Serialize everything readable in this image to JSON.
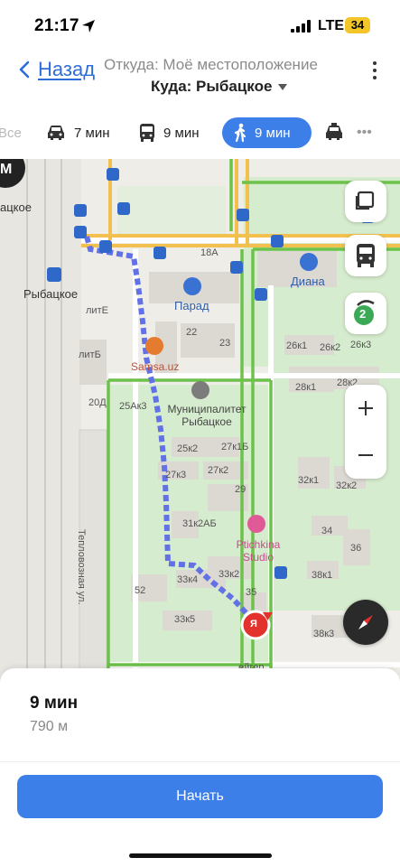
{
  "status_bar": {
    "time": "21:17",
    "network": "LTE",
    "battery": "34"
  },
  "header": {
    "back_label": "Назад",
    "from": "Откуда: Моё местоположение",
    "to": "Куда: Рыбацкое"
  },
  "modes": {
    "all": "Все",
    "car": "7 мин",
    "bus": "9 мин",
    "walk": "9 мин",
    "more": "•••",
    "selected": "walk"
  },
  "map": {
    "badge_top": "М",
    "place_top": "ацкое",
    "station": "Рыбацкое",
    "parad": "Парад",
    "diana": "Диана",
    "samsa": "Samsa.uz",
    "municipal": "Муниципалитет Рыбацкое",
    "studio": "Ptichkina Studio",
    "street": "Тепловозная ул.",
    "bottom_street": "...ейгер...",
    "transport_count": "2",
    "destination_marker": "Я",
    "house_numbers": [
      "18А",
      "литЕ",
      "литБ",
      "20Д",
      "22",
      "23",
      "25Ак3",
      "25к2",
      "27к1Б",
      "27к3",
      "27к2",
      "29",
      "31к2АБ",
      "33к4",
      "33к2",
      "35",
      "33к5",
      "52",
      "26к1",
      "26к2",
      "26к3",
      "28к1",
      "28к2",
      "32к1",
      "32к2",
      "34",
      "36",
      "38к1",
      "38к3"
    ],
    "colors": {
      "route": "#6271e6",
      "metro": "#2f68c9",
      "park": "#cfe8c4",
      "highway": "#f2c04e"
    }
  },
  "sheet": {
    "duration": "9 мин",
    "distance": "790 м",
    "start_label": "Начать"
  }
}
